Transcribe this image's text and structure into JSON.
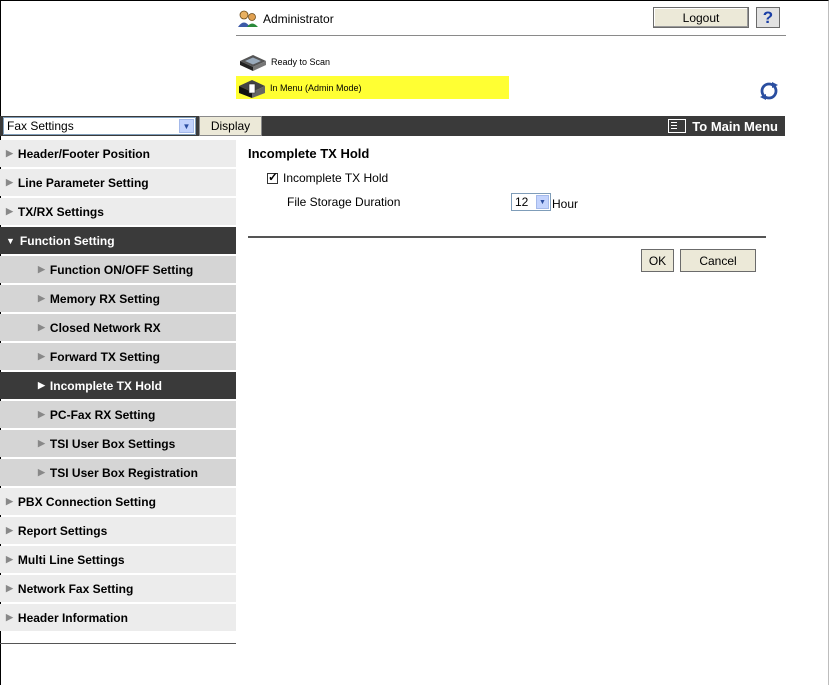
{
  "header": {
    "user_label": "Administrator",
    "logout_label": "Logout",
    "help_label": "?",
    "status_ready": "Ready to Scan",
    "status_menu": "In Menu (Admin Mode)"
  },
  "toolbar": {
    "category_selected": "Fax Settings",
    "display_label": "Display",
    "to_main_menu_label": "To Main Menu"
  },
  "sidebar": {
    "items": [
      {
        "label": "Header/Footer Position"
      },
      {
        "label": "Line Parameter Setting"
      },
      {
        "label": "TX/RX Settings"
      },
      {
        "label": "Function Setting"
      },
      {
        "label": "Function ON/OFF Setting"
      },
      {
        "label": "Memory RX Setting"
      },
      {
        "label": "Closed Network RX"
      },
      {
        "label": "Forward TX Setting"
      },
      {
        "label": "Incomplete TX Hold"
      },
      {
        "label": "PC-Fax RX Setting"
      },
      {
        "label": "TSI User Box Settings"
      },
      {
        "label": "TSI User Box Registration"
      },
      {
        "label": "PBX Connection Setting"
      },
      {
        "label": "Report Settings"
      },
      {
        "label": "Multi Line Settings"
      },
      {
        "label": "Network Fax Setting"
      },
      {
        "label": "Header Information"
      }
    ]
  },
  "main": {
    "title": "Incomplete TX Hold",
    "checkbox_label": "Incomplete TX Hold",
    "checkbox_checked": true,
    "duration_label": "File Storage Duration",
    "duration_value": "12",
    "duration_unit": "Hour",
    "ok_label": "OK",
    "cancel_label": "Cancel"
  },
  "colors": {
    "nav_dark": "#3a3a3a",
    "status_highlight": "#ffff33",
    "sidebar_light": "#ececec",
    "sidebar_sub": "#d5d5d5"
  }
}
